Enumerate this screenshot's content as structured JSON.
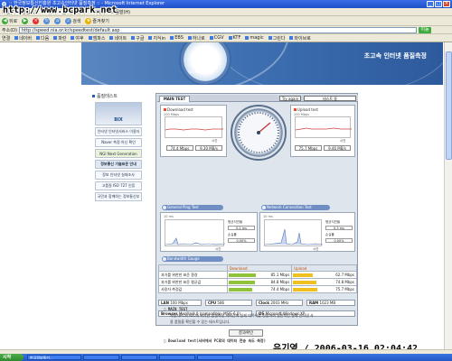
{
  "window": {
    "title": ":: 한국정보통신진흥원 초고속인터넷 품질측정 :: - Microsoft Internet Explorer",
    "min": "_",
    "max": "□",
    "close": "×"
  },
  "menubar": [
    "파일(F)",
    "편집(E)",
    "보기(V)",
    "즐겨찾기(A)",
    "도구(T)",
    "도움말(H)"
  ],
  "toolbar": {
    "back": "뒤로",
    "forward": "",
    "stop": "",
    "refresh": "",
    "home": "",
    "search": "검색",
    "favorites": "즐겨찾기"
  },
  "address": {
    "label": "주소(D)",
    "url": "http://speed.nia.or.kr/speedtest/default.asp",
    "go": "이동"
  },
  "links": [
    "연결",
    "네이버",
    "다음",
    "파란",
    "야후",
    "엠파스",
    "네이트",
    "구글",
    "지식in",
    "EBS",
    "하나로",
    "CGV",
    "KTF",
    "magic",
    "그린다",
    "와이브로"
  ],
  "banner": {
    "title": "초고속 인터넷 품질측정",
    "dial_text": "속도측정"
  },
  "sidebar": {
    "title": "품질테스트",
    "items": [
      "BIX",
      "인터넷 인터넷서비스 이용자",
      "Naver 측정 아닌 확인",
      "NGI Next Generation",
      "정보통신 기술표준 안내",
      "정보 인터넷 실태조사",
      "고품질 ISO 727 인증",
      "국민과 함께하는 정보통신부"
    ]
  },
  "panel": {
    "tab_main": "MAIN TEST",
    "tab_again": "Try again",
    "tab_test": "테스트 중",
    "download": {
      "title": "Download test",
      "scale": "200 Mbps",
      "time_label": "시간",
      "speed": "74.4 Mbps",
      "rate": "9.30 MB/s"
    },
    "upload": {
      "title": "Upload test",
      "scale": "200 Mbps",
      "time_label": "시간",
      "speed": "75.7 Mbps",
      "rate": "9.46 MB/s"
    },
    "ping_bar": "General Ping Test",
    "network_bar": "Network Connection Test",
    "ping": {
      "scale": "10 ms",
      "time_label": "시간",
      "avg_label": "평균지연율",
      "avg": "5.2 ms",
      "loss_label": "손실률",
      "loss": "0.00%"
    },
    "network": {
      "scale": "10 ms",
      "time_label": "시간",
      "avg_label": "평균지연율",
      "avg": "5.3 ms",
      "loss_label": "손실률",
      "loss": "0.00%"
    },
    "bandwidth_bar": "Bandwidth Gauge",
    "table": {
      "headers": [
        "",
        "Download",
        "Upload"
      ],
      "rows": [
        {
          "label": "과거를 위한한 표준 환경",
          "down": "85.1 Mbps",
          "down_pct": 0.43,
          "up": "62.7 Mbps",
          "up_pct": 0.31
        },
        {
          "label": "과거를 위한한 표준 평균값",
          "down": "84.8 Mbps",
          "down_pct": 0.42,
          "up": "74.8 Mbps",
          "up_pct": 0.37
        },
        {
          "label": "사용자 측정값",
          "down": "74.4 Mbps",
          "down_pct": 0.37,
          "up": "75.7 Mbps",
          "up_pct": 0.38
        }
      ]
    },
    "sys": {
      "lan_label": "LAN",
      "lan": "100 Mbps",
      "cpu_label": "CPU",
      "cpu": "586",
      "clock_label": "Clock",
      "clock": "2003 MHz",
      "ram_label": "RAM",
      "ram": "1023 MB",
      "browser_label": "Browser",
      "browser": "Mozilla/4.0 (compatible; MSIE 6.0)",
      "os_label": "OS",
      "os": "Microsoft Windows XP"
    }
  },
  "result_button": "결과확인",
  "description": {
    "main_title": "MAIN TEST",
    "main_text_1": "사용자PC와 IDC에 위치한 품질측정 서버간에 실제 데이터를 전송하여 일반적인 실제 인터넷 사",
    "main_text_2": "용 품질을 확인할 수 있는 테스트입니다.",
    "download_title": "Download test(서버에서 PC로의 데이터 전송 속도 측정)"
  },
  "watermark": "http://www.bcpark.net",
  "timestamp": "유기영 / 2006-03-16 02:04:42",
  "taskbar": {
    "start": "시작",
    "items": [
      "한국정보통신..",
      "",
      "",
      "",
      ""
    ]
  }
}
